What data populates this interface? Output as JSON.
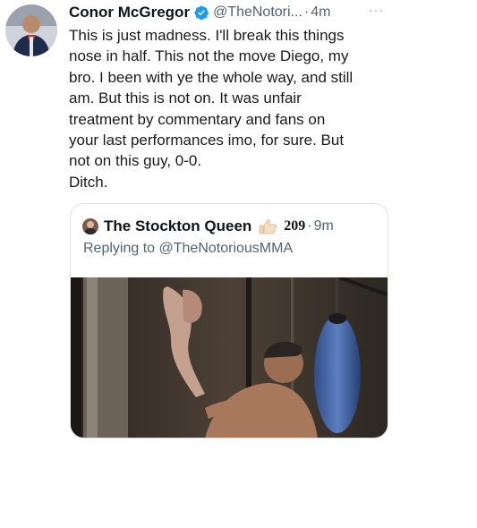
{
  "tweet": {
    "author_name": "Conor McGregor",
    "handle": "@TheNotori...",
    "separator": "·",
    "time": "4m",
    "more_label": "···",
    "verified_icon": "verified-badge-icon",
    "text": "This is just madness. I'll break this things\nnose in half. This not the move Diego, my\nbro. I been with ye the whole way, and still\nam. But this is not on. It was unfair\ntreatment by commentary and fans on\nyour last performances imo, for sure. But\nnot on this guy, 0-0.\nDitch."
  },
  "quoted_tweet": {
    "author_name": "The Stockton Queen",
    "emoji_icon": "thumbs-up-emoji-icon",
    "count": "209",
    "separator": "·",
    "time": "9m",
    "reply_prefix": "Replying to ",
    "reply_mention": "@TheNotoriousMMA"
  },
  "colors": {
    "verified_blue": "#1d9bf0",
    "secondary_text": "#536471",
    "border": "#dfe3e7"
  }
}
